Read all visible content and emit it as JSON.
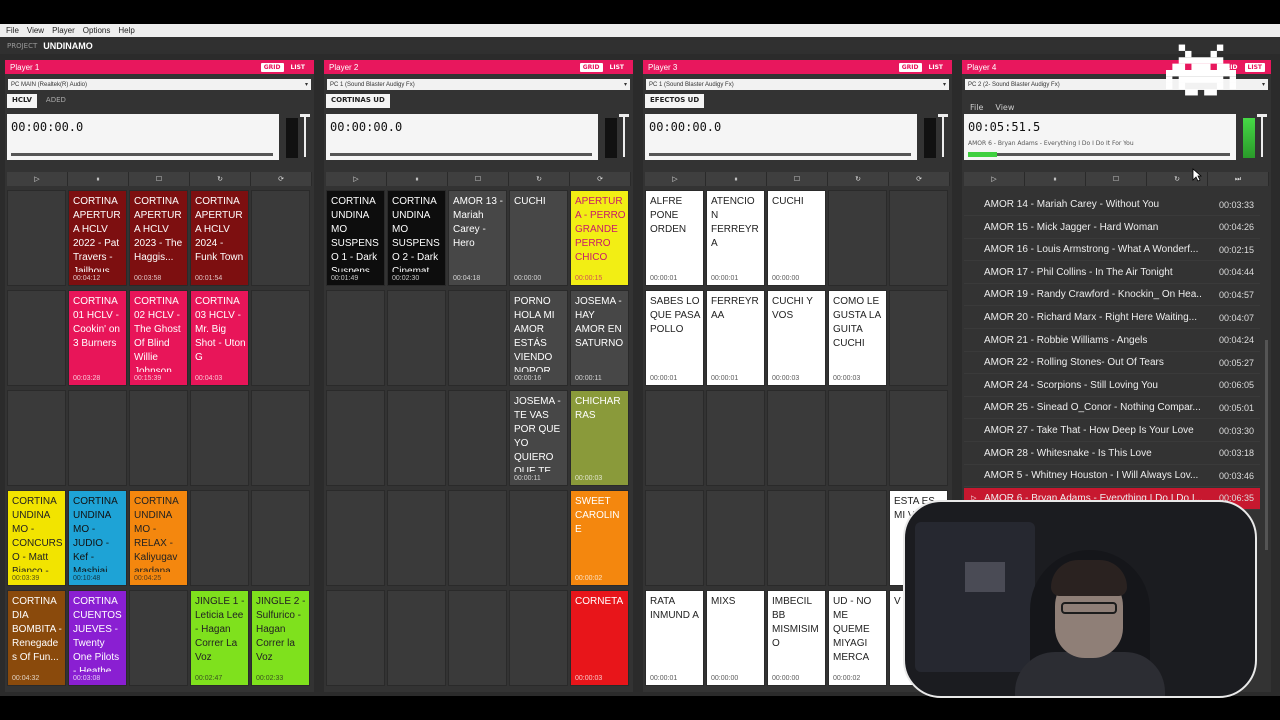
{
  "menu": [
    "File",
    "View",
    "Player",
    "Options",
    "Help"
  ],
  "project": {
    "label": "PROJECT",
    "name": "UNDINAMO"
  },
  "modes": {
    "grid": "GRID",
    "list": "LIST"
  },
  "controls": {
    "play": "▷",
    "pause": "⏸",
    "stop": "☐",
    "loop": "↻",
    "reset": "⟳",
    "next": "⏭"
  },
  "players": [
    {
      "title": "Player 1",
      "device": "PC MAIN (Realtek(R) Audio)",
      "tabs": [
        "HCLV",
        "ADED"
      ],
      "time": "00:00:00.0",
      "cells": [
        {
          "r": 0,
          "c": 1,
          "t": "CORTINA APERTUR A HCLV 2022 - Pat Travers - Jailhous...",
          "d": "00:04:12",
          "bg": "#7d0f10",
          "fg": "#ffffff"
        },
        {
          "r": 0,
          "c": 2,
          "t": "CORTINA APERTUR A HCLV 2023 - The Haggis...",
          "d": "00:03:58",
          "bg": "#7d0f10",
          "fg": "#ffffff"
        },
        {
          "r": 0,
          "c": 3,
          "t": "CORTINA APERTUR A HCLV 2024 - Funk Town",
          "d": "00:01:54",
          "bg": "#7d0f10",
          "fg": "#ffffff"
        },
        {
          "r": 1,
          "c": 1,
          "t": "CORTINA 01 HCLV - Cookin' on 3 Burners",
          "d": "00:03:28",
          "bg": "#e81559",
          "fg": "#ffffff"
        },
        {
          "r": 1,
          "c": 2,
          "t": "CORTINA 02 HCLV - The Ghost Of Blind Willie Johnson",
          "d": "00:15:39",
          "bg": "#e81559",
          "fg": "#ffffff"
        },
        {
          "r": 1,
          "c": 3,
          "t": "CORTINA 03 HCLV - Mr. Big Shot - Uton G",
          "d": "00:04:03",
          "bg": "#e81559",
          "fg": "#ffffff"
        },
        {
          "r": 3,
          "c": 0,
          "t": "CORTINA UNDINA MO - CONCURS O - Matt Bianco -...",
          "d": "00:03:39",
          "bg": "#f2e400",
          "fg": "#222222"
        },
        {
          "r": 3,
          "c": 1,
          "t": "CORTINA UNDINA MO - JUDIO - Kef - Mashiaj",
          "d": "00:10:48",
          "bg": "#1ea3d6",
          "fg": "#111111"
        },
        {
          "r": 3,
          "c": 2,
          "t": "CORTINA UNDINA MO - RELAX - Kaliyugav aradana",
          "d": "00:04:25",
          "bg": "#f4870e",
          "fg": "#222222"
        },
        {
          "r": 4,
          "c": 0,
          "t": "CORTINA DIA BOMBITA - Renegade s Of Fun...",
          "d": "00:04:32",
          "bg": "#8a4a0c",
          "fg": "#ffffff"
        },
        {
          "r": 4,
          "c": 1,
          "t": "CORTINA CUENTOS JUEVES - Twenty One Pilots - Heathe...",
          "d": "00:03:08",
          "bg": "#8a1fd2",
          "fg": "#ffffff"
        },
        {
          "r": 4,
          "c": 3,
          "t": "JINGLE 1 - Leticia Lee - Hagan Correr La Voz",
          "d": "00:02:47",
          "bg": "#7fe11d",
          "fg": "#222222"
        },
        {
          "r": 4,
          "c": 4,
          "t": "JINGLE 2 - Sulfurico - Hagan Correr la Voz",
          "d": "00:02:33",
          "bg": "#7fe11d",
          "fg": "#222222"
        }
      ]
    },
    {
      "title": "Player 2",
      "device": "PC 1 (Sound Blaster Audigy Fx)",
      "tabs": [
        "CORTINAS UD"
      ],
      "time": "00:00:00.0",
      "cells": [
        {
          "r": 0,
          "c": 0,
          "t": "CORTINA UNDINA MO SUSPENS O 1 - Dark Suspens...",
          "d": "00:01:49",
          "bg": "#0d0d0d",
          "fg": "#ffffff"
        },
        {
          "r": 0,
          "c": 1,
          "t": "CORTINA UNDINA MO SUSPENS O 2 - Dark Cinemat...",
          "d": "00:02:30",
          "bg": "#0d0d0d",
          "fg": "#ffffff"
        },
        {
          "r": 0,
          "c": 2,
          "t": "AMOR 13 - Mariah Carey - Hero",
          "d": "00:04:18",
          "bg": "#474747",
          "fg": "#ffffff"
        },
        {
          "r": 0,
          "c": 3,
          "t": "CUCHI",
          "d": "00:00:00",
          "bg": "#474747",
          "fg": "#ffffff"
        },
        {
          "r": 0,
          "c": 4,
          "t": "APERTUR A - PERRO GRANDE PERRO CHICO",
          "d": "00:00:15",
          "bg": "#f2ee14",
          "fg": "#c81a6a"
        },
        {
          "r": 1,
          "c": 3,
          "t": "PORNO HOLA MI AMOR ESTÁS VIENDO NOPOR...",
          "d": "00:00:16",
          "bg": "#474747",
          "fg": "#ffffff"
        },
        {
          "r": 1,
          "c": 4,
          "t": "JOSEMA - HAY AMOR EN SATURNO",
          "d": "00:00:11",
          "bg": "#474747",
          "fg": "#ffffff"
        },
        {
          "r": 2,
          "c": 3,
          "t": "JOSEMA - TE VAS POR QUE YO QUIERO QUE TE...",
          "d": "00:00:11",
          "bg": "#474747",
          "fg": "#ffffff"
        },
        {
          "r": 2,
          "c": 4,
          "t": "CHICHAR RAS",
          "d": "00:00:03",
          "bg": "#8a9a3a",
          "fg": "#ffffff"
        },
        {
          "r": 3,
          "c": 4,
          "t": "SWEET CAROLINE",
          "d": "00:00:02",
          "bg": "#f4870e",
          "fg": "#ffffff"
        },
        {
          "r": 4,
          "c": 4,
          "t": "CORNETA",
          "d": "00:00:03",
          "bg": "#e8151a",
          "fg": "#ffffff"
        }
      ]
    },
    {
      "title": "Player 3",
      "device": "PC 1 (Sound Blaster Audigy Fx)",
      "tabs": [
        "EFECTOS UD"
      ],
      "time": "00:00:00.0",
      "cells": [
        {
          "r": 0,
          "c": 0,
          "t": "ALFRE PONE ORDEN",
          "d": "00:00:01",
          "bg": "#ffffff",
          "fg": "#222222"
        },
        {
          "r": 0,
          "c": 1,
          "t": "ATENCIO N FERREYRA",
          "d": "00:00:01",
          "bg": "#ffffff",
          "fg": "#222222"
        },
        {
          "r": 0,
          "c": 2,
          "t": "CUCHI",
          "d": "00:00:00",
          "bg": "#ffffff",
          "fg": "#222222"
        },
        {
          "r": 1,
          "c": 0,
          "t": "SABES LO QUE PASA POLLO",
          "d": "00:00:01",
          "bg": "#ffffff",
          "fg": "#222222"
        },
        {
          "r": 1,
          "c": 1,
          "t": "FERREYR AA",
          "d": "00:00:01",
          "bg": "#ffffff",
          "fg": "#222222"
        },
        {
          "r": 1,
          "c": 2,
          "t": "CUCHI Y VOS",
          "d": "00:00:03",
          "bg": "#ffffff",
          "fg": "#222222"
        },
        {
          "r": 1,
          "c": 3,
          "t": "COMO LE GUSTA LA GUITA CUCHI",
          "d": "00:00:03",
          "bg": "#ffffff",
          "fg": "#222222"
        },
        {
          "r": 3,
          "c": 4,
          "t": "ESTA ES MI VI UN",
          "d": "",
          "bg": "#ffffff",
          "fg": "#222222"
        },
        {
          "r": 4,
          "c": 0,
          "t": "RATA INMUND A",
          "d": "00:00:01",
          "bg": "#ffffff",
          "fg": "#222222"
        },
        {
          "r": 4,
          "c": 1,
          "t": "MIXS",
          "d": "00:00:00",
          "bg": "#ffffff",
          "fg": "#222222"
        },
        {
          "r": 4,
          "c": 2,
          "t": "IMBECIL BB MISMISIM O",
          "d": "00:00:00",
          "bg": "#ffffff",
          "fg": "#222222"
        },
        {
          "r": 4,
          "c": 3,
          "t": "UD - NO ME QUEME MIYAGI MERCA",
          "d": "00:00:02",
          "bg": "#ffffff",
          "fg": "#222222"
        },
        {
          "r": 4,
          "c": 4,
          "t": "V",
          "d": "",
          "bg": "#ffffff",
          "fg": "#222222"
        }
      ]
    },
    {
      "title": "Player 4",
      "device": "PC 2 (2- Sound Blaster Audigy Fx)",
      "filemenu": [
        "File",
        "View"
      ],
      "time": "00:05:51.5",
      "track": "AMOR 6 - Bryan Adams - Everything I Do I Do It For You",
      "progress": 0.11,
      "list": [
        {
          "t": "AMOR 14 - Mariah Carey - Without You",
          "d": "00:03:33"
        },
        {
          "t": "AMOR 15 - Mick Jagger - Hard Woman",
          "d": "00:04:26"
        },
        {
          "t": "AMOR 16 - Louis Armstrong - What A Wonderf...",
          "d": "00:02:15"
        },
        {
          "t": "AMOR 17 - Phil Collins - In The Air Tonight",
          "d": "00:04:44"
        },
        {
          "t": "AMOR 19 - Randy Crawford - Knockin_ On Hea...",
          "d": "00:04:57"
        },
        {
          "t": "AMOR 20 - Richard Marx - Right Here Waiting...",
          "d": "00:04:07"
        },
        {
          "t": "AMOR 21 - Robbie Williams - Angels",
          "d": "00:04:24"
        },
        {
          "t": "AMOR 22 - Rolling Stones- Out Of Tears",
          "d": "00:05:27"
        },
        {
          "t": "AMOR 24 - Scorpions - Still Loving You",
          "d": "00:06:05"
        },
        {
          "t": "AMOR 25 - Sinead O_Conor - Nothing Compar...",
          "d": "00:05:01"
        },
        {
          "t": "AMOR 27 - Take That - How Deep Is Your Love",
          "d": "00:03:30"
        },
        {
          "t": "AMOR 28 - Whitesnake - Is This Love",
          "d": "00:03:18"
        },
        {
          "t": "AMOR 5 - Whitney Houston - I Will Always Lov...",
          "d": "00:03:46"
        },
        {
          "t": "AMOR 6 - Bryan Adams - Everything I Do I Do I...",
          "d": "00:06:35",
          "sel": true
        }
      ]
    }
  ],
  "colors": {
    "accent": "#e8175d",
    "progress": "#3fd03f",
    "selected": "#c7182f"
  }
}
